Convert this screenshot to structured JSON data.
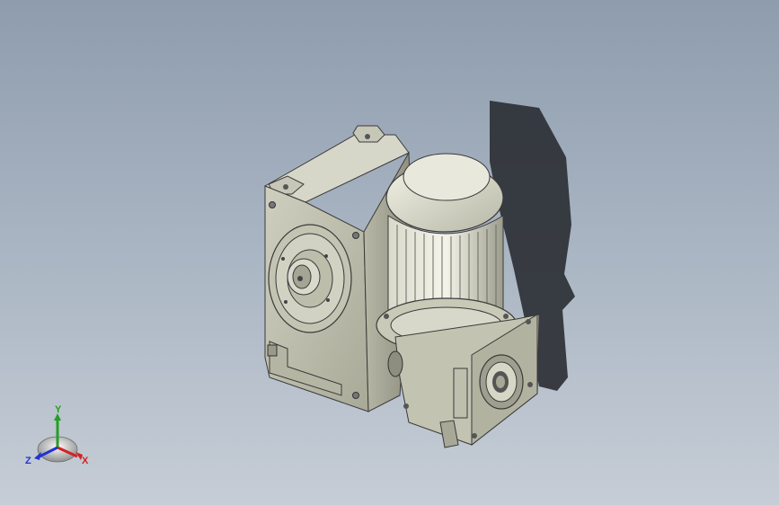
{
  "viewport": {
    "background_top": "#8e9cad",
    "background_bottom": "#c6cdd6",
    "model_body_color": "#c9c9b8",
    "model_edge_color": "#3a3a3a",
    "shadow_color": "#2a2d33"
  },
  "triad": {
    "x_label": "X",
    "y_label": "Y",
    "z_label": "Z",
    "x_color": "#d22323",
    "y_color": "#22a022",
    "z_color": "#2233d2"
  }
}
